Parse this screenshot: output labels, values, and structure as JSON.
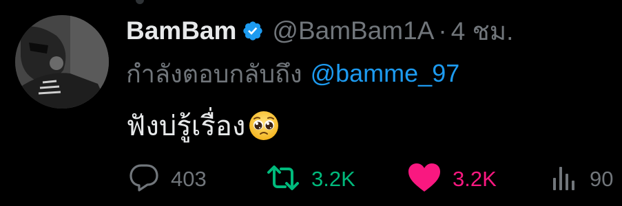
{
  "tweet": {
    "author": {
      "display_name": "BamBam",
      "handle": "@BamBam1A",
      "verified": true
    },
    "separator": "·",
    "time_ago": "4 ชม.",
    "reply_prefix": "กำลังตอบกลับถึง",
    "reply_mention": "@bamme_97",
    "text": "ฟังบ่รู้เรื่อง",
    "emoji": "pleading-face-emoji"
  },
  "actions": {
    "reply_count": "403",
    "retweet_count": "3.2K",
    "like_count": "3.2K",
    "views_count": "90"
  },
  "icons": {
    "reply": "reply-bubble-icon",
    "retweet": "retweet-icon",
    "like": "heart-icon",
    "views": "views-bar-icon",
    "verified": "verified-badge-icon"
  },
  "colors": {
    "background": "#000000",
    "primary_text": "#e7e9ea",
    "secondary_text": "#71767b",
    "link": "#1d9bf0",
    "retweet": "#00ba7c",
    "like": "#f91880",
    "verified": "#1d9bf0"
  }
}
